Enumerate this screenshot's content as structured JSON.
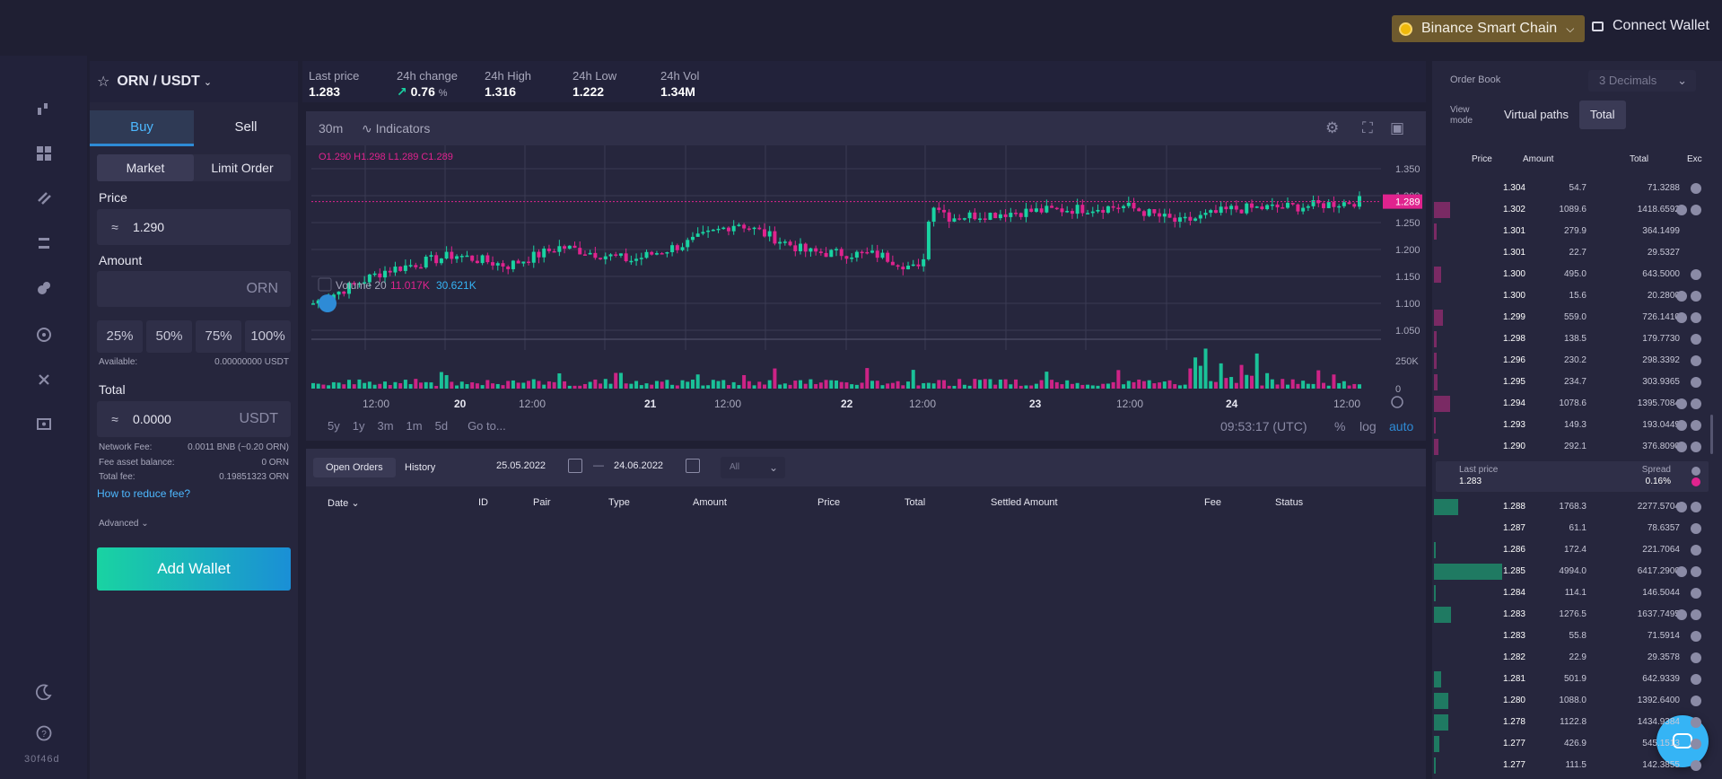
{
  "topbar": {
    "chain": "Binance Smart Chain",
    "connect_wallet": "Connect Wallet"
  },
  "rail": {
    "build_id": "30f46d"
  },
  "pair": {
    "base": "ORN",
    "sep": "/",
    "quote": "USDT"
  },
  "form": {
    "tab_buy": "Buy",
    "tab_sell": "Sell",
    "type_market": "Market",
    "type_limit": "Limit Order",
    "price_label": "Price",
    "approx": "≈",
    "price_value": "1.290",
    "amount_label": "Amount",
    "amount_unit": "ORN",
    "pct": [
      "25%",
      "50%",
      "75%",
      "100%"
    ],
    "available_label": "Available:",
    "available_value": "0.00000000 USDT",
    "total_label": "Total",
    "total_value": "0.0000",
    "total_unit": "USDT",
    "network_fee_label": "Network Fee:",
    "network_fee_value": "0.0011 BNB (~0.20 ORN)",
    "fee_asset_label": "Fee asset balance:",
    "fee_asset_value": "0 ORN",
    "total_fee_label": "Total fee:",
    "total_fee_value": "0.19851323 ORN",
    "reduce_fee_link": "How to reduce fee?",
    "advanced": "Advanced",
    "add_wallet": "Add Wallet"
  },
  "stats": [
    {
      "label": "Last price",
      "value": "1.283"
    },
    {
      "label": "24h change",
      "value": "0.76",
      "unit": "%"
    },
    {
      "label": "24h High",
      "value": "1.316"
    },
    {
      "label": "24h Low",
      "value": "1.222"
    },
    {
      "label": "24h Vol",
      "value": "1.34M"
    }
  ],
  "chart": {
    "timeframe": "30m",
    "indicators": "Indicators",
    "ohlc": {
      "O": "1.290",
      "H": "1.298",
      "L": "1.289",
      "C": "1.289"
    },
    "price_tag": "1.289",
    "y_ticks": [
      "1.350",
      "1.300",
      "1.250",
      "1.200",
      "1.150",
      "1.100",
      "1.050"
    ],
    "volume_label": "Volume 20",
    "volume_v1": "11.017K",
    "volume_v2": "30.621K",
    "vol_ticks": [
      "250K",
      "0"
    ],
    "x_ticks": [
      "12:00",
      "20",
      "12:00",
      "21",
      "12:00",
      "22",
      "12:00",
      "23",
      "12:00",
      "24",
      "12:00"
    ],
    "ranges": [
      "5y",
      "1y",
      "3m",
      "1m",
      "5d"
    ],
    "goto": "Go to...",
    "clock": "09:53:17 (UTC)",
    "pct": "%",
    "log": "log",
    "auto": "auto",
    "colors": {
      "up": "#19d3a2",
      "down": "#e0238e",
      "grid": "#3a3a52"
    }
  },
  "orders": {
    "tab_open": "Open Orders",
    "tab_history": "History",
    "date_from": "25.05.2022",
    "date_dash": "—",
    "date_to": "24.06.2022",
    "filter": "All",
    "columns": [
      "Date",
      "ID",
      "Pair",
      "Type",
      "Amount",
      "Price",
      "Total",
      "Settled Amount",
      "Fee",
      "Status"
    ]
  },
  "orderbook": {
    "title": "Order Book",
    "decimals": "3 Decimals",
    "view_mode_label": "View mode",
    "vm_virtual": "Virtual paths",
    "vm_total": "Total",
    "columns": [
      "Price",
      "Amount",
      "Total",
      "Exc"
    ],
    "asks": [
      {
        "price": "1.304",
        "amount": "54.7",
        "total": "71.3288",
        "ex": 1,
        "depth": 0.0
      },
      {
        "price": "1.302",
        "amount": "1089.6",
        "total": "1418.6592",
        "ex": 2,
        "depth": 0.22
      },
      {
        "price": "1.301",
        "amount": "279.9",
        "total": "364.1499",
        "ex": 0,
        "depth": 0.04
      },
      {
        "price": "1.301",
        "amount": "22.7",
        "total": "29.5327",
        "ex": 0,
        "depth": 0.0
      },
      {
        "price": "1.300",
        "amount": "495.0",
        "total": "643.5000",
        "ex": 1,
        "depth": 0.1
      },
      {
        "price": "1.300",
        "amount": "15.6",
        "total": "20.2800",
        "ex": 2,
        "depth": 0.0
      },
      {
        "price": "1.299",
        "amount": "559.0",
        "total": "726.1410",
        "ex": 2,
        "depth": 0.12
      },
      {
        "price": "1.298",
        "amount": "138.5",
        "total": "179.7730",
        "ex": 1,
        "depth": 0.04
      },
      {
        "price": "1.296",
        "amount": "230.2",
        "total": "298.3392",
        "ex": 1,
        "depth": 0.04
      },
      {
        "price": "1.295",
        "amount": "234.7",
        "total": "303.9365",
        "ex": 1,
        "depth": 0.05
      },
      {
        "price": "1.294",
        "amount": "1078.6",
        "total": "1395.7084",
        "ex": 2,
        "depth": 0.22
      },
      {
        "price": "1.293",
        "amount": "149.3",
        "total": "193.0449",
        "ex": 2,
        "depth": 0.03
      },
      {
        "price": "1.290",
        "amount": "292.1",
        "total": "376.8090",
        "ex": 2,
        "depth": 0.06
      }
    ],
    "mid": {
      "last_label": "Last price",
      "last_value": "1.283",
      "spread_label": "Spread",
      "spread_value": "0.16%"
    },
    "bids": [
      {
        "price": "1.288",
        "amount": "1768.3",
        "total": "2277.5704",
        "ex": 2,
        "depth": 0.34
      },
      {
        "price": "1.287",
        "amount": "61.1",
        "total": "78.6357",
        "ex": 1,
        "depth": 0.0
      },
      {
        "price": "1.286",
        "amount": "172.4",
        "total": "221.7064",
        "ex": 1,
        "depth": 0.02
      },
      {
        "price": "1.285",
        "amount": "4994.0",
        "total": "6417.2900",
        "ex": 2,
        "depth": 0.95
      },
      {
        "price": "1.284",
        "amount": "114.1",
        "total": "146.5044",
        "ex": 1,
        "depth": 0.02
      },
      {
        "price": "1.283",
        "amount": "1276.5",
        "total": "1637.7495",
        "ex": 2,
        "depth": 0.24
      },
      {
        "price": "1.283",
        "amount": "55.8",
        "total": "71.5914",
        "ex": 1,
        "depth": 0.0
      },
      {
        "price": "1.282",
        "amount": "22.9",
        "total": "29.3578",
        "ex": 1,
        "depth": 0.0
      },
      {
        "price": "1.281",
        "amount": "501.9",
        "total": "642.9339",
        "ex": 1,
        "depth": 0.1
      },
      {
        "price": "1.280",
        "amount": "1088.0",
        "total": "1392.6400",
        "ex": 1,
        "depth": 0.2
      },
      {
        "price": "1.278",
        "amount": "1122.8",
        "total": "1434.9384",
        "ex": 1,
        "depth": 0.2
      },
      {
        "price": "1.277",
        "amount": "426.9",
        "total": "545.1513",
        "ex": 1,
        "depth": 0.08
      },
      {
        "price": "1.277",
        "amount": "111.5",
        "total": "142.3855",
        "ex": 1,
        "depth": 0.02
      }
    ]
  }
}
